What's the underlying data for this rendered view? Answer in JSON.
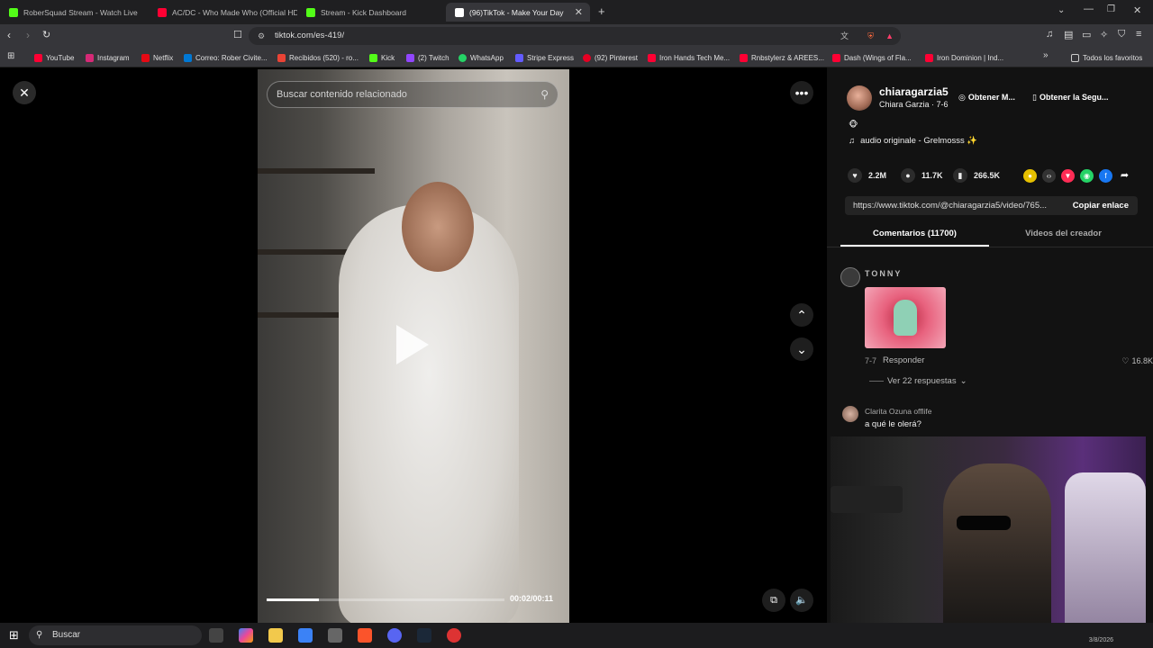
{
  "browser": {
    "tabs": [
      {
        "title": "RoberSquad Stream - Watch Live",
        "favicon_color": "#53fc18"
      },
      {
        "title": "AC/DC - Who Made Who (Official HD",
        "favicon_color": "#ff0033"
      },
      {
        "title": "Stream - Kick Dashboard",
        "favicon_color": "#53fc18"
      },
      {
        "title": "(96)TikTok - Make Your Day",
        "favicon_color": "#ffffff"
      }
    ],
    "url": "tiktok.com/es-419/",
    "bookmarks": [
      {
        "label": "YouTube",
        "color": "#ff0033"
      },
      {
        "label": "Instagram",
        "color": "#d62976"
      },
      {
        "label": "Netflix",
        "color": "#e50914"
      },
      {
        "label": "Correo: Rober Civite...",
        "color": "#0078d4"
      },
      {
        "label": "Recibidos (520) - ro...",
        "color": "#ea4335"
      },
      {
        "label": "Kick",
        "color": "#53fc18"
      },
      {
        "label": "(2) Twitch",
        "color": "#9146ff"
      },
      {
        "label": "WhatsApp",
        "color": "#25d366"
      },
      {
        "label": "Stripe Express",
        "color": "#635bff"
      },
      {
        "label": "(92) Pinterest",
        "color": "#e60023"
      },
      {
        "label": "Iron Hands Tech Me...",
        "color": "#ff0033"
      },
      {
        "label": "Rnbstylerz & AREES...",
        "color": "#ff0033"
      },
      {
        "label": "Dash (Wings of Fla...",
        "color": "#ff0033"
      },
      {
        "label": "Iron Dominion | Ind...",
        "color": "#ff0033"
      }
    ],
    "all_bookmarks": "Todos los favoritos"
  },
  "player": {
    "search_placeholder": "Buscar contenido relacionado",
    "timecode": "00:02/00:11",
    "progress": 0.22
  },
  "creator": {
    "username": "chiaragarzia5",
    "display": "Chiara Garzia · 7-6",
    "get_button_1": "Obtener M...",
    "get_button_2": "Obtener la Segu...",
    "emoji": "🐵",
    "audio": "audio originale - Grelmosss ✨"
  },
  "stats": {
    "likes": "2.2M",
    "comments": "11.7K",
    "saves": "266.5K"
  },
  "share": {
    "link": "https://www.tiktok.com/@chiaragarzia5/video/765...",
    "copy_label": "Copiar enlace"
  },
  "panel_tabs": {
    "comments": "Comentarios (11700)",
    "creator_videos": "Videos del creador"
  },
  "comments": [
    {
      "user": "TONNY",
      "date": "7-7",
      "reply": "Responder",
      "likes": "16.8K",
      "replies": "Ver 22 respuestas"
    },
    {
      "user": "Clarita Ozuna offlife",
      "text": "a qué le olerá?"
    }
  ],
  "taskbar": {
    "search": "Buscar",
    "date": "3/8/2026"
  }
}
